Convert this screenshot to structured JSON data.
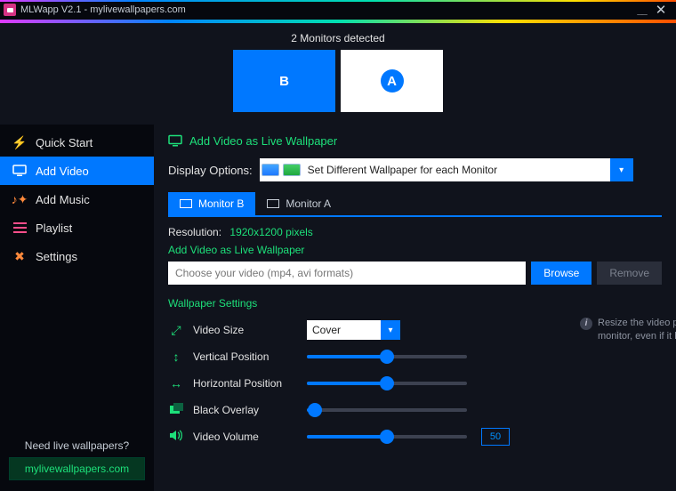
{
  "titlebar": {
    "title": "MLWapp V2.1 - mylivewallpapers.com"
  },
  "monitors": {
    "status": "2 Monitors detected",
    "b": "B",
    "a": "A"
  },
  "sidebar": {
    "items": [
      {
        "label": "Quick Start"
      },
      {
        "label": "Add Video"
      },
      {
        "label": "Add Music"
      },
      {
        "label": "Playlist"
      },
      {
        "label": "Settings"
      }
    ],
    "footer_q": "Need live wallpapers?",
    "footer_link": "mylivewallpapers.com"
  },
  "content": {
    "header_action": "Add Video as Live Wallpaper",
    "display_options_label": "Display Options:",
    "display_options_value": "Set Different Wallpaper for each Monitor",
    "tabs": [
      {
        "label": "Monitor B"
      },
      {
        "label": "Monitor A"
      }
    ],
    "resolution_label": "Resolution:",
    "resolution_value": "1920x1200 pixels",
    "add_video_sub": "Add Video as Live Wallpaper",
    "file_placeholder": "Choose your video (mp4, avi formats)",
    "browse": "Browse",
    "remove": "Remove",
    "settings_title": "Wallpaper Settings",
    "video_size_label": "Video Size",
    "video_size_value": "Cover",
    "hint": "Resize the video proportionately to cover the monitor, even if it has to cut the edges",
    "vp_label": "Vertical Position",
    "hp_label": "Horizontal Position",
    "bo_label": "Black Overlay",
    "vv_label": "Video Volume",
    "vv_value": "50",
    "sliders": {
      "vp": 50,
      "hp": 50,
      "bo": 5,
      "vv": 50
    }
  }
}
